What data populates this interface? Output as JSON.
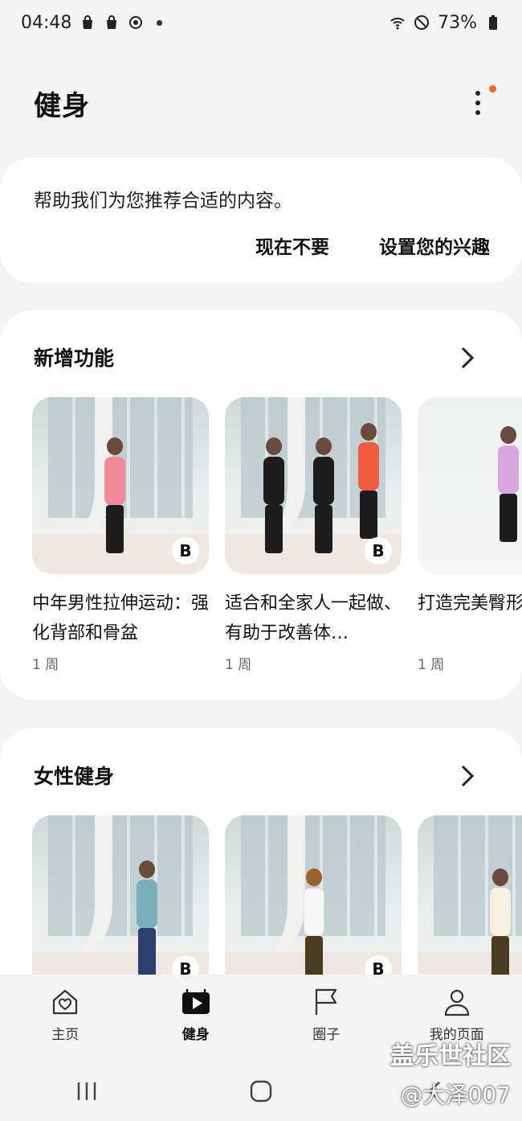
{
  "status": {
    "time": "04:48",
    "battery": "73%"
  },
  "header": {
    "title": "健身"
  },
  "recommendation": {
    "text": "帮助我们为您推荐合适的内容。",
    "not_now": "现在不要",
    "set_interests": "设置您的兴趣"
  },
  "sections": [
    {
      "title": "新增功能",
      "items": [
        {
          "title": "中年男性拉伸运动：强化背部和骨盆",
          "age": "1 周",
          "badge": "B"
        },
        {
          "title": "适合和全家人一起做、有助于改善体…",
          "age": "1 周",
          "badge": "B"
        },
        {
          "title": "打造完美臀形",
          "age": "1 周",
          "badge": ""
        }
      ]
    },
    {
      "title": "女性健身",
      "items": [
        {
          "badge": "B"
        },
        {
          "badge": "B"
        },
        {
          "badge": ""
        }
      ]
    }
  ],
  "bottom_nav": [
    {
      "label": "主页",
      "icon": "home-heart-icon"
    },
    {
      "label": "健身",
      "icon": "play-icon"
    },
    {
      "label": "圈子",
      "icon": "flag-icon"
    },
    {
      "label": "我的页面",
      "icon": "person-icon"
    }
  ],
  "watermark": {
    "line1": "盖乐世社区",
    "line2": "@大泽007"
  },
  "colors": {
    "background": "#f4f4f4",
    "card": "#ffffff",
    "notification": "#f06b1f"
  }
}
